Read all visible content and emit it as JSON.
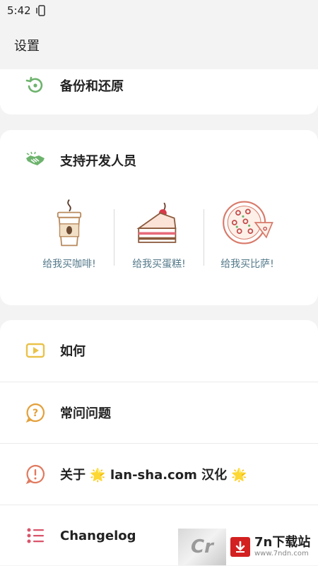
{
  "status_bar": {
    "time": "5:42"
  },
  "app_bar": {
    "title": "设置"
  },
  "backup": {
    "label": "备份和还原"
  },
  "support": {
    "title": "支持开发人员",
    "items": [
      {
        "label": "给我买咖啡!"
      },
      {
        "label": "给我买蛋糕!"
      },
      {
        "label": "给我买比萨!"
      }
    ]
  },
  "menu": {
    "items": [
      {
        "label": "如何"
      },
      {
        "label": "常问问题"
      },
      {
        "label": "关于 🌟 lan-sha.com 汉化 🌟"
      },
      {
        "label": "Changelog"
      }
    ]
  },
  "watermark": {
    "logo": "Cr",
    "name": "7n下载站",
    "url": "www.7ndn.com"
  },
  "colors": {
    "accent_green": "#6db36d",
    "howto_yellow": "#e9c24a",
    "faq_orange": "#e3a03a",
    "about_red": "#e07a5f",
    "changelog_red": "#d9546a",
    "donate_text": "#557a8a"
  }
}
